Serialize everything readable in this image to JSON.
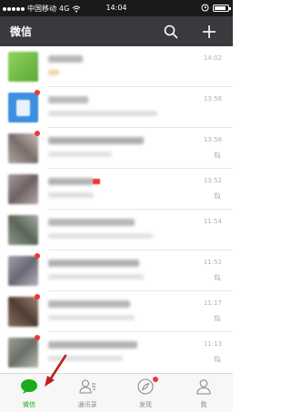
{
  "status": {
    "carrier": "中国移动",
    "network": "4G",
    "time": "14:04"
  },
  "header": {
    "title": "微信"
  },
  "chats": [
    {
      "time": "14:02",
      "muted": false,
      "avatar_color": "#7bc24a"
    },
    {
      "time": "13:58",
      "muted": false,
      "avatar_color": "#3d8fe0"
    },
    {
      "time": "13:58",
      "muted": true,
      "avatar_color": "#9a8c8a"
    },
    {
      "time": "13:52",
      "muted": true,
      "avatar_color": "#8a7e7e"
    },
    {
      "time": "11:54",
      "muted": false,
      "avatar_color": "#7d8a7a"
    },
    {
      "time": "11:52",
      "muted": true,
      "avatar_color": "#8c8a94"
    },
    {
      "time": "11:17",
      "muted": true,
      "avatar_color": "#6e5a50"
    },
    {
      "time": "11:13",
      "muted": true,
      "avatar_color": "#8a9088"
    }
  ],
  "tabs": [
    {
      "label": "微信",
      "active": true
    },
    {
      "label": "通讯录",
      "active": false
    },
    {
      "label": "发现",
      "active": false
    },
    {
      "label": "我",
      "active": false
    }
  ],
  "colors": {
    "accent": "#1aad19",
    "header_bg": "#393a3e",
    "badge": "#f43530",
    "annotation_arrow": "#c0201a"
  }
}
